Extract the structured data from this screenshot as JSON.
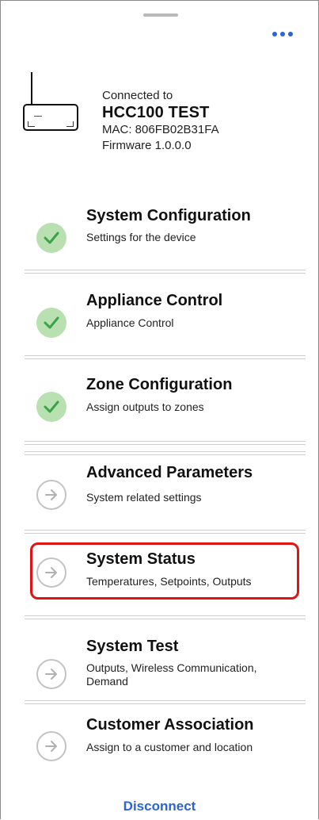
{
  "device": {
    "connected_label": "Connected to",
    "name": "HCC100 TEST",
    "mac": "MAC: 806FB02B31FA",
    "firmware": "Firmware 1.0.0.0"
  },
  "menu_items": [
    {
      "title": "System Configuration",
      "subtitle": "Settings for the device",
      "status": "complete"
    },
    {
      "title": "Appliance Control",
      "subtitle": "Appliance Control",
      "status": "complete"
    },
    {
      "title": "Zone Configuration",
      "subtitle": "Assign outputs to zones",
      "status": "complete"
    },
    {
      "title": "Advanced Parameters",
      "subtitle": "System related settings",
      "status": "pending"
    },
    {
      "title": "System Status",
      "subtitle": "Temperatures, Setpoints, Outputs",
      "status": "pending",
      "highlighted": true
    },
    {
      "title": "System Test",
      "subtitle": "Outputs, Wireless Communication, Demand",
      "status": "pending"
    },
    {
      "title": "Customer Association",
      "subtitle": "Assign to a customer and location",
      "status": "pending"
    }
  ],
  "footer": {
    "disconnect_label": "Disconnect"
  },
  "icons": {
    "more": "more-dots-icon",
    "device": "router-icon",
    "complete": "check-icon",
    "pending": "arrow-right-circle-icon"
  },
  "colors": {
    "accent": "#2b63d9",
    "check_bg": "#b8e0b0",
    "check_mark": "#3ca24a",
    "highlight": "#e01414"
  }
}
